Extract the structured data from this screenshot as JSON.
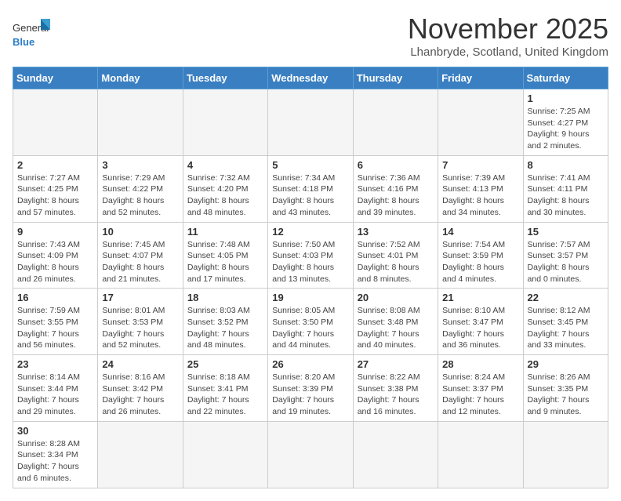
{
  "header": {
    "logo_text_general": "General",
    "logo_text_blue": "Blue",
    "month_title": "November 2025",
    "location": "Lhanbryde, Scotland, United Kingdom"
  },
  "days_of_week": [
    "Sunday",
    "Monday",
    "Tuesday",
    "Wednesday",
    "Thursday",
    "Friday",
    "Saturday"
  ],
  "weeks": [
    [
      {
        "day": "",
        "info": ""
      },
      {
        "day": "",
        "info": ""
      },
      {
        "day": "",
        "info": ""
      },
      {
        "day": "",
        "info": ""
      },
      {
        "day": "",
        "info": ""
      },
      {
        "day": "",
        "info": ""
      },
      {
        "day": "1",
        "info": "Sunrise: 7:25 AM\nSunset: 4:27 PM\nDaylight: 9 hours and 2 minutes."
      }
    ],
    [
      {
        "day": "2",
        "info": "Sunrise: 7:27 AM\nSunset: 4:25 PM\nDaylight: 8 hours and 57 minutes."
      },
      {
        "day": "3",
        "info": "Sunrise: 7:29 AM\nSunset: 4:22 PM\nDaylight: 8 hours and 52 minutes."
      },
      {
        "day": "4",
        "info": "Sunrise: 7:32 AM\nSunset: 4:20 PM\nDaylight: 8 hours and 48 minutes."
      },
      {
        "day": "5",
        "info": "Sunrise: 7:34 AM\nSunset: 4:18 PM\nDaylight: 8 hours and 43 minutes."
      },
      {
        "day": "6",
        "info": "Sunrise: 7:36 AM\nSunset: 4:16 PM\nDaylight: 8 hours and 39 minutes."
      },
      {
        "day": "7",
        "info": "Sunrise: 7:39 AM\nSunset: 4:13 PM\nDaylight: 8 hours and 34 minutes."
      },
      {
        "day": "8",
        "info": "Sunrise: 7:41 AM\nSunset: 4:11 PM\nDaylight: 8 hours and 30 minutes."
      }
    ],
    [
      {
        "day": "9",
        "info": "Sunrise: 7:43 AM\nSunset: 4:09 PM\nDaylight: 8 hours and 26 minutes."
      },
      {
        "day": "10",
        "info": "Sunrise: 7:45 AM\nSunset: 4:07 PM\nDaylight: 8 hours and 21 minutes."
      },
      {
        "day": "11",
        "info": "Sunrise: 7:48 AM\nSunset: 4:05 PM\nDaylight: 8 hours and 17 minutes."
      },
      {
        "day": "12",
        "info": "Sunrise: 7:50 AM\nSunset: 4:03 PM\nDaylight: 8 hours and 13 minutes."
      },
      {
        "day": "13",
        "info": "Sunrise: 7:52 AM\nSunset: 4:01 PM\nDaylight: 8 hours and 8 minutes."
      },
      {
        "day": "14",
        "info": "Sunrise: 7:54 AM\nSunset: 3:59 PM\nDaylight: 8 hours and 4 minutes."
      },
      {
        "day": "15",
        "info": "Sunrise: 7:57 AM\nSunset: 3:57 PM\nDaylight: 8 hours and 0 minutes."
      }
    ],
    [
      {
        "day": "16",
        "info": "Sunrise: 7:59 AM\nSunset: 3:55 PM\nDaylight: 7 hours and 56 minutes."
      },
      {
        "day": "17",
        "info": "Sunrise: 8:01 AM\nSunset: 3:53 PM\nDaylight: 7 hours and 52 minutes."
      },
      {
        "day": "18",
        "info": "Sunrise: 8:03 AM\nSunset: 3:52 PM\nDaylight: 7 hours and 48 minutes."
      },
      {
        "day": "19",
        "info": "Sunrise: 8:05 AM\nSunset: 3:50 PM\nDaylight: 7 hours and 44 minutes."
      },
      {
        "day": "20",
        "info": "Sunrise: 8:08 AM\nSunset: 3:48 PM\nDaylight: 7 hours and 40 minutes."
      },
      {
        "day": "21",
        "info": "Sunrise: 8:10 AM\nSunset: 3:47 PM\nDaylight: 7 hours and 36 minutes."
      },
      {
        "day": "22",
        "info": "Sunrise: 8:12 AM\nSunset: 3:45 PM\nDaylight: 7 hours and 33 minutes."
      }
    ],
    [
      {
        "day": "23",
        "info": "Sunrise: 8:14 AM\nSunset: 3:44 PM\nDaylight: 7 hours and 29 minutes."
      },
      {
        "day": "24",
        "info": "Sunrise: 8:16 AM\nSunset: 3:42 PM\nDaylight: 7 hours and 26 minutes."
      },
      {
        "day": "25",
        "info": "Sunrise: 8:18 AM\nSunset: 3:41 PM\nDaylight: 7 hours and 22 minutes."
      },
      {
        "day": "26",
        "info": "Sunrise: 8:20 AM\nSunset: 3:39 PM\nDaylight: 7 hours and 19 minutes."
      },
      {
        "day": "27",
        "info": "Sunrise: 8:22 AM\nSunset: 3:38 PM\nDaylight: 7 hours and 16 minutes."
      },
      {
        "day": "28",
        "info": "Sunrise: 8:24 AM\nSunset: 3:37 PM\nDaylight: 7 hours and 12 minutes."
      },
      {
        "day": "29",
        "info": "Sunrise: 8:26 AM\nSunset: 3:35 PM\nDaylight: 7 hours and 9 minutes."
      }
    ],
    [
      {
        "day": "30",
        "info": "Sunrise: 8:28 AM\nSunset: 3:34 PM\nDaylight: 7 hours and 6 minutes."
      },
      {
        "day": "",
        "info": ""
      },
      {
        "day": "",
        "info": ""
      },
      {
        "day": "",
        "info": ""
      },
      {
        "day": "",
        "info": ""
      },
      {
        "day": "",
        "info": ""
      },
      {
        "day": "",
        "info": ""
      }
    ]
  ]
}
